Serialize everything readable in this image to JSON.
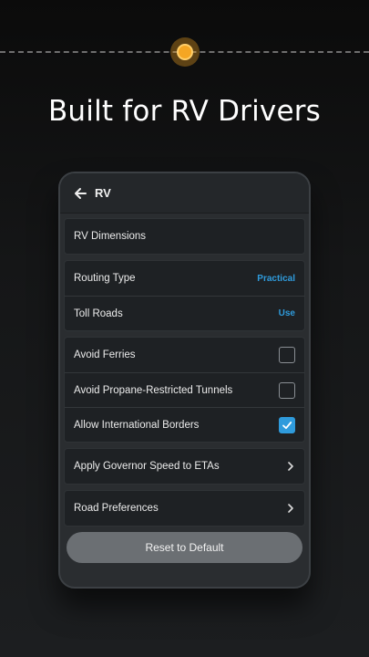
{
  "headline": "Built for RV Drivers",
  "appbar": {
    "title": "RV",
    "back_icon": "arrow-left-icon"
  },
  "sections": {
    "dimensions": {
      "label": "RV Dimensions"
    },
    "routing": {
      "routing_type_label": "Routing Type",
      "routing_type_value": "Practical",
      "toll_roads_label": "Toll Roads",
      "toll_roads_value": "Use"
    },
    "avoid": {
      "ferries_label": "Avoid Ferries",
      "ferries_checked": false,
      "tunnels_label": "Avoid Propane-Restricted Tunnels",
      "tunnels_checked": false,
      "borders_label": "Allow International Borders",
      "borders_checked": true
    },
    "governor": {
      "label": "Apply Governor Speed to ETAs"
    },
    "road_prefs": {
      "label": "Road Preferences"
    }
  },
  "reset_label": "Reset to Default",
  "colors": {
    "accent": "#2f9bdc",
    "route_dot": "#f5a623"
  }
}
